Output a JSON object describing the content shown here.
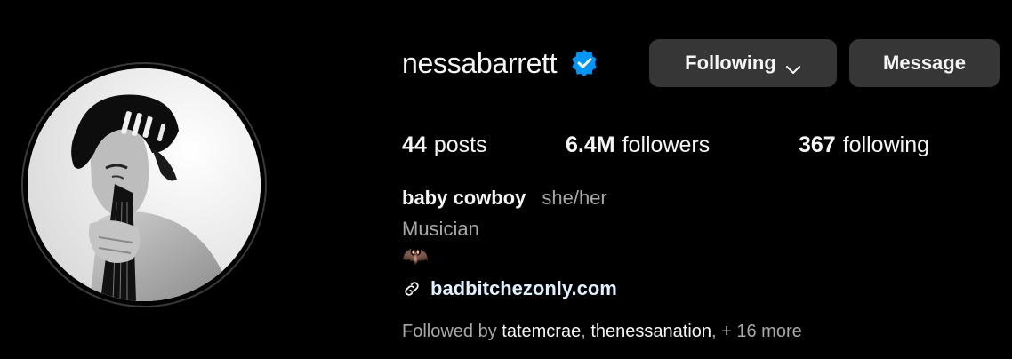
{
  "profile": {
    "username": "nessabarrett",
    "verified": true,
    "full_name": "baby cowboy",
    "pronouns": "she/her",
    "category": "Musician",
    "bio_emoji": "🦇",
    "link": "badbitchezonly.com"
  },
  "buttons": {
    "following": "Following",
    "message": "Message"
  },
  "stats": {
    "posts_count": "44",
    "posts_label": "posts",
    "followers_count": "6.4M",
    "followers_label": "followers",
    "following_count": "367",
    "following_label": "following"
  },
  "followed_by": {
    "prefix": "Followed by ",
    "user1": "tatemcrae",
    "sep1": ", ",
    "user2": "thenessanation",
    "sep2": ", ",
    "more": "+ 16 more"
  },
  "icons": {
    "verified": "verified-badge-icon",
    "chevron": "chevron-down-icon",
    "link": "link-icon"
  },
  "colors": {
    "background": "#000000",
    "text": "#f5f5f5",
    "secondary_text": "#a8a8a8",
    "button_bg": "#363636",
    "verified_blue": "#0095f6",
    "link_text": "#e0f1ff"
  }
}
